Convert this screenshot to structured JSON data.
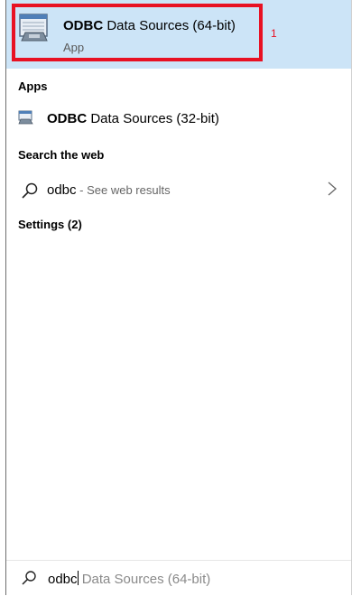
{
  "best_match": {
    "title_bold": "ODBC",
    "title_rest": " Data Sources (64-bit)",
    "subtitle": "App",
    "badge": "1",
    "icon": "odbc-database-icon"
  },
  "sections": {
    "apps_header": "Apps",
    "search_web_header": "Search the web",
    "settings_header": "Settings (2)"
  },
  "apps": [
    {
      "title_bold": "ODBC",
      "title_rest": " Data Sources (32-bit)",
      "icon": "odbc-database-icon"
    }
  ],
  "web_result": {
    "query": "odbc",
    "suffix": " - See web results",
    "icon": "search-icon",
    "chevron": "chevron-right-icon"
  },
  "search_bar": {
    "typed": "odbc",
    "suggestion": " Data Sources (64-bit)",
    "icon": "search-icon"
  },
  "colors": {
    "highlight_bg": "#cce4f7",
    "annotation_red": "#e81123"
  }
}
